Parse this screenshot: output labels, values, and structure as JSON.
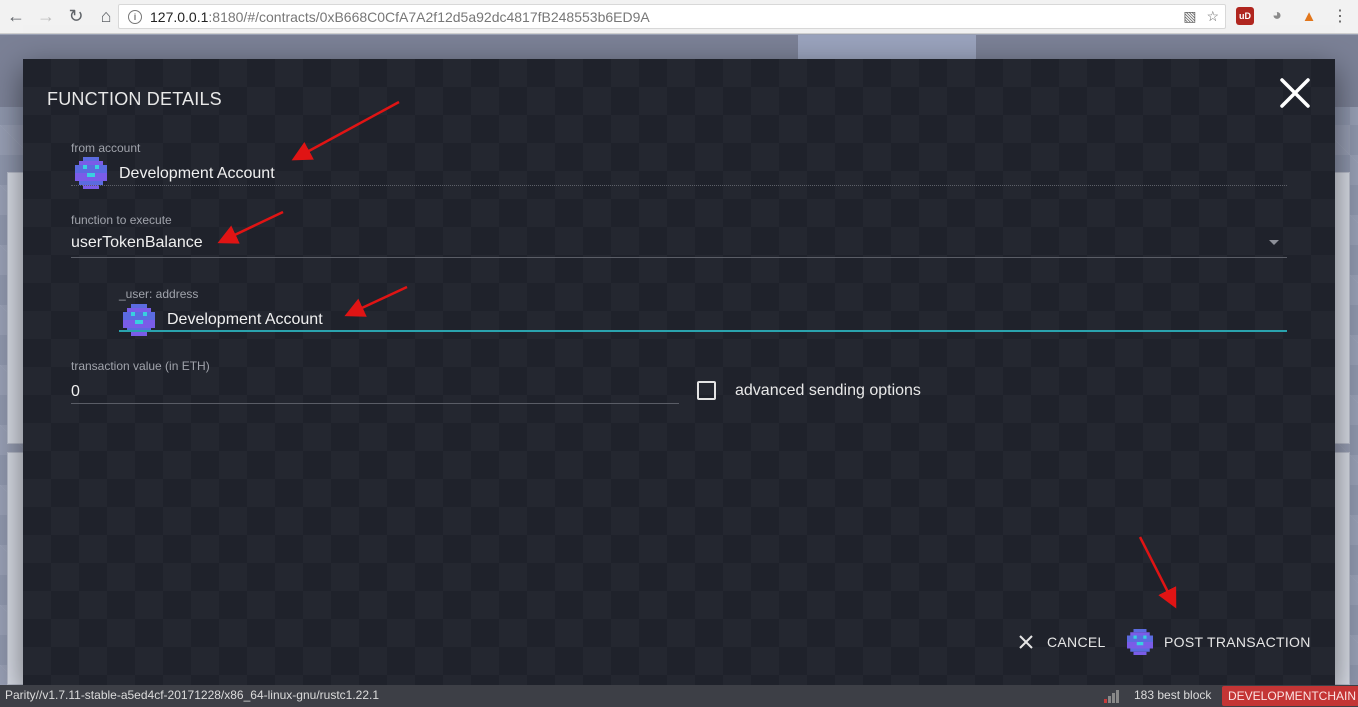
{
  "browser": {
    "url_host": "127.0.0.1",
    "url_path": ":8180/#/contracts/0xB668C0CfA7A2f12d5a92dc4817fB248553b6ED9A",
    "ublock_label": "uD"
  },
  "modal": {
    "title": "FUNCTION DETAILS",
    "from_account": {
      "label": "from account",
      "value": "Development Account"
    },
    "function_to_execute": {
      "label": "function to execute",
      "value": "userTokenBalance"
    },
    "user_param": {
      "label": "_user: address",
      "value": "Development Account"
    },
    "transaction_value": {
      "label": "transaction value (in ETH)",
      "value": "0"
    },
    "advanced_options": {
      "label": "advanced sending options",
      "checked": false
    },
    "actions": {
      "cancel": "CANCEL",
      "post": "POST TRANSACTION"
    }
  },
  "status_bar": {
    "version": "Parity//v1.7.11-stable-a5ed4cf-20171228/x86_64-linux-gnu/rustc1.22.1",
    "blocks": "183 best block",
    "chain": "DEVELOPMENTCHAIN"
  },
  "colors": {
    "accent": "#2aa3ae",
    "chain_badge": "#c43535",
    "annotation_arrow": "#e01414"
  }
}
